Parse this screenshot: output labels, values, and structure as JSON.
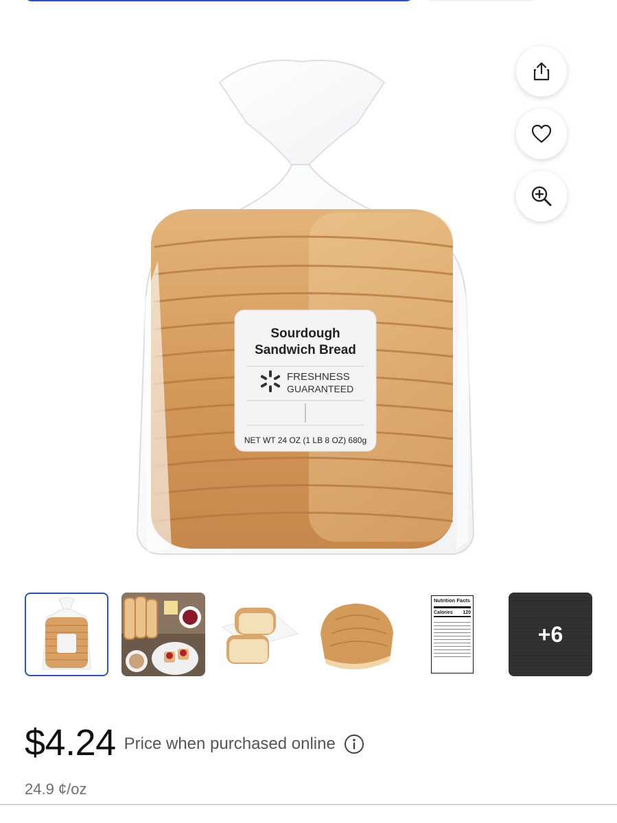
{
  "hero": {
    "label_title_line1": "Sourdough",
    "label_title_line2": "Sandwich Bread",
    "label_badge_line1": "FRESHNESS",
    "label_badge_line2": "GUARANTEED",
    "label_net_wt": "NET WT 24 OZ (1 LB 8 OZ) 680g"
  },
  "actions": {
    "share_icon": "share-icon",
    "favorite_icon": "heart-icon",
    "zoom_icon": "zoom-in-icon"
  },
  "thumbnails": {
    "selected_index": 0,
    "more_count": "+6",
    "nutrition_title": "Nutrition Facts",
    "nutrition_calories_label": "Calories",
    "nutrition_calories_value": "120"
  },
  "pricing": {
    "price": "$4.24",
    "price_note": "Price when purchased online",
    "unit_price": "24.9 ¢/oz"
  }
}
